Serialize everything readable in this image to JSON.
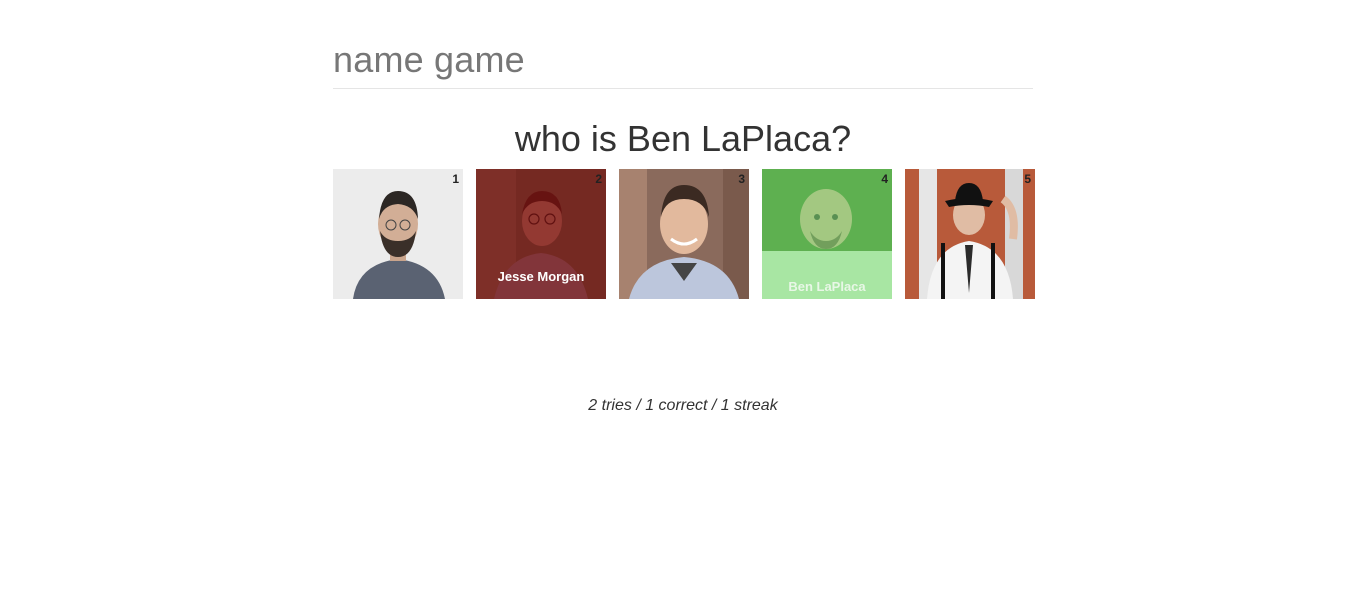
{
  "header": {
    "title": "name game"
  },
  "question": {
    "text": "who is Ben LaPlaca?"
  },
  "photos": [
    {
      "number": "1",
      "revealed_name": "",
      "state": "unanswered",
      "icon": "person-photo-icon"
    },
    {
      "number": "2",
      "revealed_name": "Jesse Morgan",
      "state": "wrong",
      "icon": "person-photo-icon"
    },
    {
      "number": "3",
      "revealed_name": "",
      "state": "unanswered",
      "icon": "person-photo-icon"
    },
    {
      "number": "4",
      "revealed_name": "Ben LaPlaca",
      "state": "correct",
      "icon": "person-photo-icon"
    },
    {
      "number": "5",
      "revealed_name": "",
      "state": "unanswered",
      "icon": "person-photo-icon"
    }
  ],
  "stats": {
    "text": "2 tries / 1 correct / 1 streak"
  },
  "colors": {
    "wrong_overlay": "#780a0a",
    "correct_overlay": "#78dc6e",
    "correct_band": "#a8e6a3"
  }
}
